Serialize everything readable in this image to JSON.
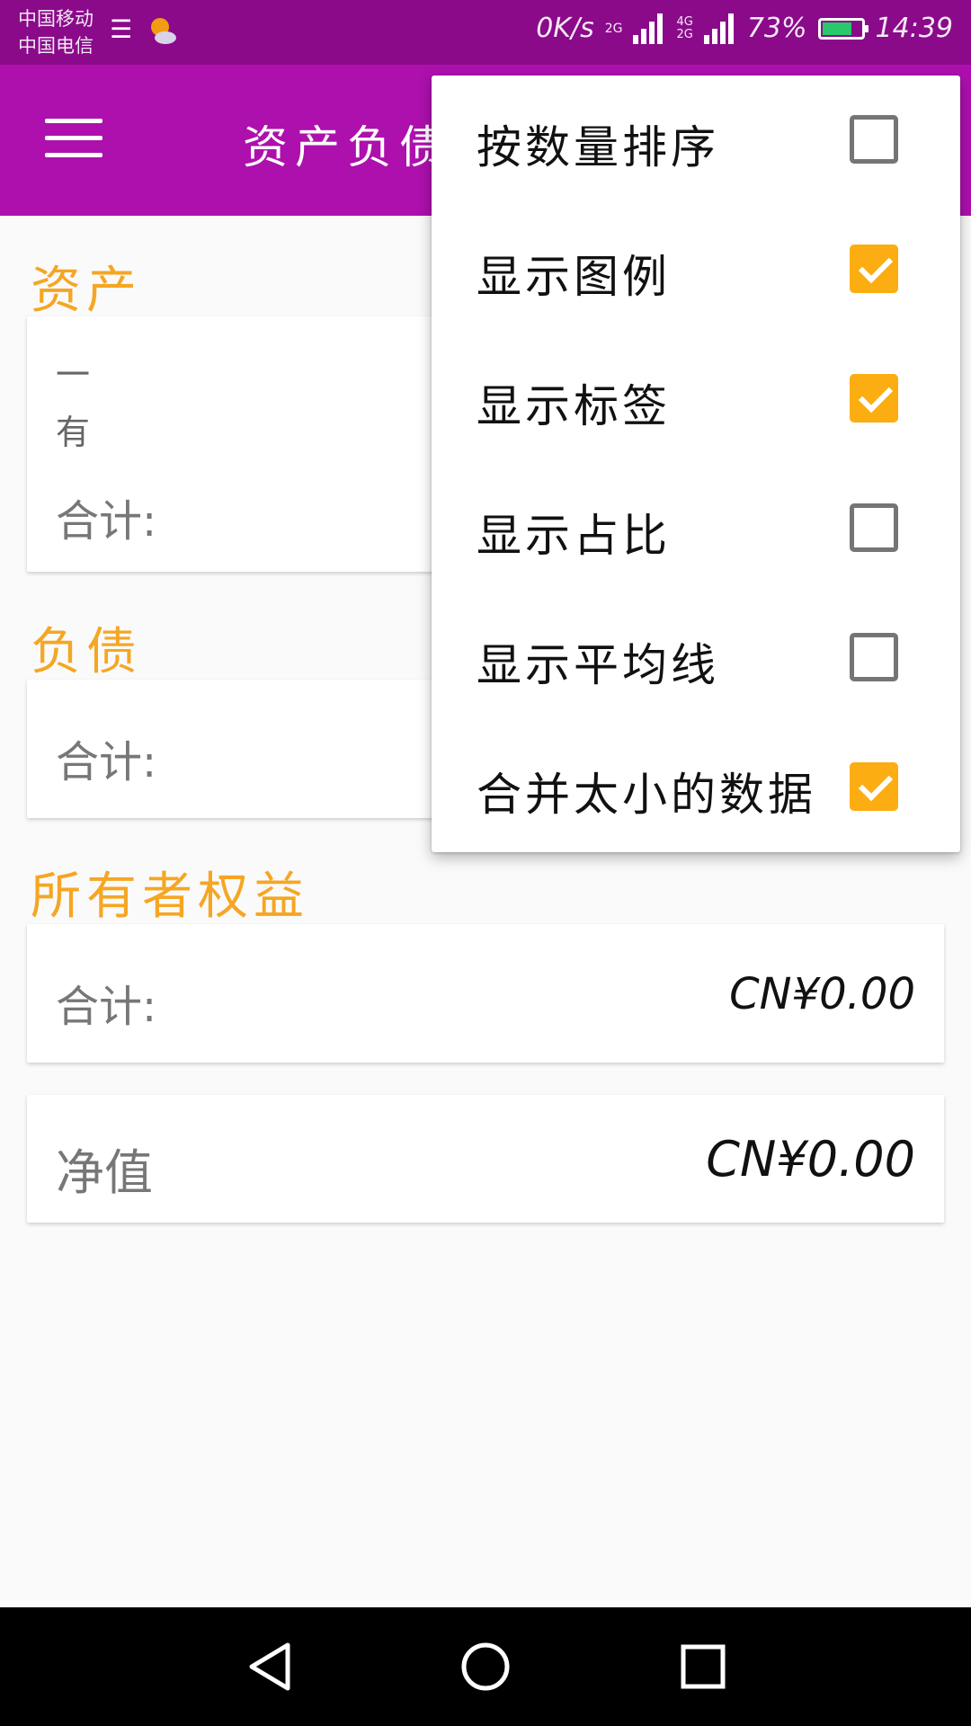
{
  "status": {
    "carrier1": "中国移动",
    "carrier2": "中国电信",
    "speed": "0K/s",
    "net1": "2G",
    "net2": "4G",
    "net3": "2G",
    "battery": "73%",
    "time": "14:39"
  },
  "appbar": {
    "title": "资产负债"
  },
  "assets": {
    "label": "资产",
    "item1": "一",
    "item2": "有",
    "total_label": "合计:"
  },
  "liabilities": {
    "label": "负债",
    "total_label": "合计:"
  },
  "equity": {
    "label": "所有者权益",
    "total_label": "合计:",
    "total_value": "CN¥0.00"
  },
  "networth": {
    "label": "净值",
    "value": "CN¥0.00"
  },
  "menu": {
    "items": [
      {
        "label": "按数量排序",
        "checked": false
      },
      {
        "label": "显示图例",
        "checked": true
      },
      {
        "label": "显示标签",
        "checked": true
      },
      {
        "label": "显示占比",
        "checked": false
      },
      {
        "label": "显示平均线",
        "checked": false
      },
      {
        "label": "合并太小的数据",
        "checked": true
      }
    ]
  },
  "colors": {
    "status_bar": "#8a0a8a",
    "app_bar": "#ad10ad",
    "accent": "#f5a623",
    "checkbox_checked": "#fbad12"
  },
  "icons": {
    "usb": "usb-icon",
    "weather": "weather-icon",
    "menu": "hamburger-menu-icon",
    "back": "nav-back-icon",
    "home": "nav-home-icon",
    "recents": "nav-recents-icon"
  }
}
